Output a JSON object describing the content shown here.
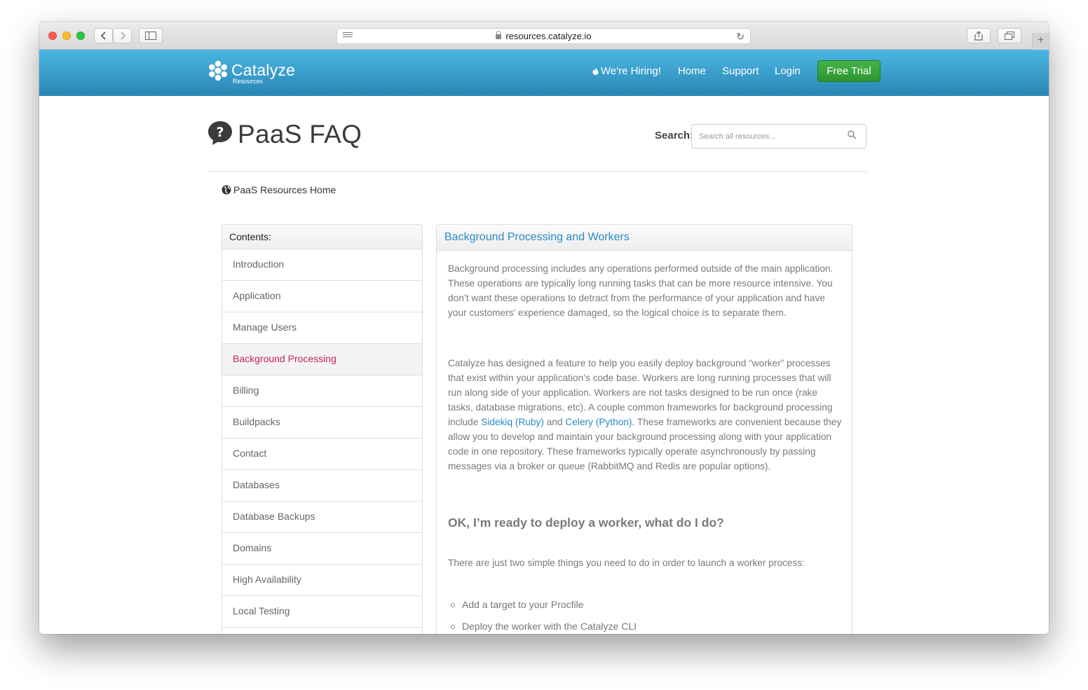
{
  "browser": {
    "url": "resources.catalyze.io"
  },
  "header": {
    "brand": "Catalyze",
    "brand_sub": "Resources",
    "nav": [
      "We're Hiring!",
      "Home",
      "Support",
      "Login"
    ],
    "cta": "Free Trial",
    "color_start": "#4bb6e3",
    "color_end": "#2a86b3"
  },
  "page": {
    "title": "PaaS FAQ",
    "search_label": "Search:",
    "search_placeholder": "Search all resources...",
    "home_link": "PaaS Resources Home"
  },
  "sidebar": {
    "heading": "Contents:",
    "items": [
      "Introduction",
      "Application",
      "Manage Users",
      "Background Processing",
      "Billing",
      "Buildpacks",
      "Contact",
      "Databases",
      "Database Backups",
      "Domains",
      "High Availability",
      "Local Testing"
    ],
    "active_color": "#c7254e"
  },
  "article": {
    "heading": "Background Processing and Workers",
    "para1": "Background processing includes any operations performed outside of the main application. These operations are typically long running tasks that can be more resource intensive. You don’t want these operations to detract from the performance of your application and have your customers’ experience damaged, so the logical choice is to separate them.",
    "para2_a": "Catalyze has designed a feature to help you easily deploy background “worker” processes that exist within your application’s code base. Workers are long running processes that will run along side of your application. Workers are not tasks designed to be run once (rake tasks, database migrations, etc). A couple common frameworks for background processing include ",
    "link_sidekiq": "Sidekiq (Ruby)",
    "para2_b": " and ",
    "link_celery": "Celery (Python)",
    "para2_c": ". These frameworks are convenient because they allow you to develop and maintain your background processing along with your application code in one repository. These frameworks typically operate asynchronously by passing messages via a broker or queue (RabbitMQ and Redis are popular options).",
    "subheading": "OK, I’m ready to deploy a worker, what do I do?",
    "para3": "There are just two simple things you need to do in order to launch a worker process:",
    "steps": [
      "Add a target to your Procfile",
      "Deploy the worker with the Catalyze CLI"
    ],
    "link_color": "#2a8ac2"
  }
}
